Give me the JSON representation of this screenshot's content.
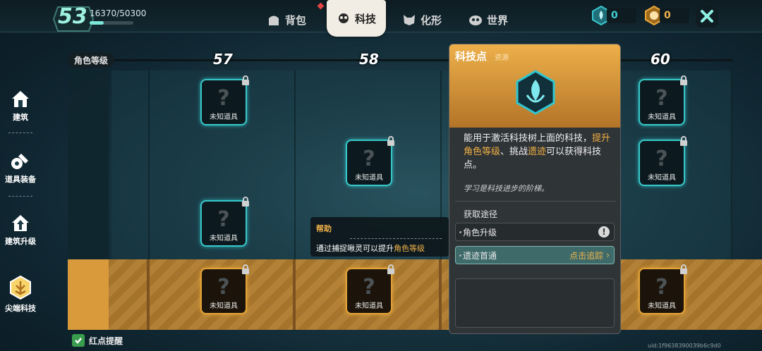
{
  "player": {
    "level": "53",
    "exp_text": "16370/50300",
    "exp_fraction": 0.325
  },
  "tabs": [
    {
      "label": "背包",
      "icon": "backpack-icon"
    },
    {
      "label": "科技",
      "icon": "tech-icon",
      "active": true
    },
    {
      "label": "化形",
      "icon": "morph-icon"
    },
    {
      "label": "世界",
      "icon": "world-icon"
    }
  ],
  "currencies": [
    {
      "icon": "tech-point-icon",
      "value": "0",
      "color": "#39c6d0"
    },
    {
      "icon": "advanced-point-icon",
      "value": "0",
      "color": "#e9a93a"
    }
  ],
  "level_row": {
    "label": "角色等级",
    "levels": [
      "57",
      "58",
      "60"
    ]
  },
  "sidebar": [
    {
      "label": "建筑",
      "icon": "house-icon"
    },
    {
      "label": "道具装备",
      "icon": "tools-icon"
    },
    {
      "label": "建筑升级",
      "icon": "house-upgrade-icon"
    },
    {
      "label": "尖端科技",
      "icon": "advanced-tech-icon",
      "active": true
    }
  ],
  "node_label": "未知道具",
  "help": {
    "title": "帮助",
    "text": "通过捕捉啾灵可以提升",
    "highlight": "角色等级"
  },
  "panel": {
    "title": "科技点",
    "subtitle": "资源",
    "desc_1": "能用于激活科技树上面的科技，",
    "desc_hl1": "提升角色等级",
    "desc_2": "、挑战",
    "desc_hl2": "遗迹",
    "desc_3": "可以获得科技点。",
    "quote": "学习是科技进步的阶梯。",
    "source_title": "获取途径",
    "sources": [
      {
        "label": "角色升级",
        "action": ""
      },
      {
        "label": "遗迹首通",
        "action": "点击追踪"
      }
    ]
  },
  "reminder": "红点提醒",
  "uid": "uid:1f9638390039b6c9d0"
}
